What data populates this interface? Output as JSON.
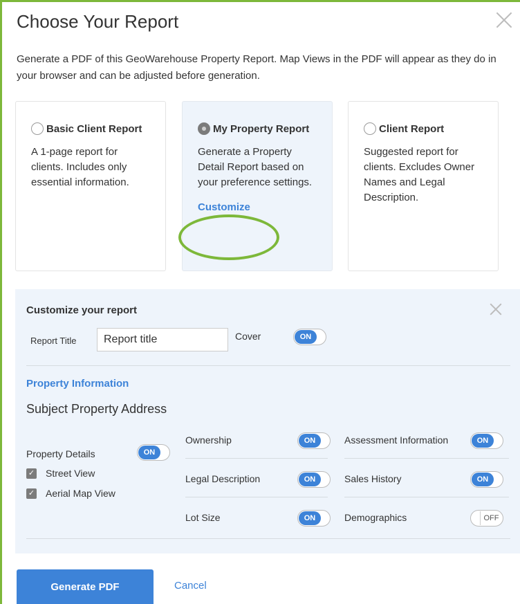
{
  "dialog": {
    "title": "Choose Your Report",
    "intro": "Generate a PDF of this GeoWarehouse Property Report. Map Views in the PDF will appear as they do in your browser and can be adjusted before generation."
  },
  "report_options": [
    {
      "label": "Basic Client Report",
      "description": "A 1-page report for clients. Includes only essential information.",
      "selected": false
    },
    {
      "label": "My Property Report",
      "description": "Generate a Property Detail Report based on your preference settings.",
      "selected": true,
      "link": "Customize"
    },
    {
      "label": "Client Report",
      "description": "Suggested report for clients. Excludes Owner Names and Legal Description.",
      "selected": false
    }
  ],
  "customize": {
    "title": "Customize your report",
    "report_title_label": "Report Title",
    "report_title_value": "Report title",
    "cover_label": "Cover",
    "cover_toggle": "ON",
    "section_title": "Property Information",
    "address_label": "Subject Property Address",
    "property_details": {
      "label": "Property Details",
      "toggle": "ON"
    },
    "checkboxes": [
      {
        "label": "Street View",
        "checked": true
      },
      {
        "label": "Aerial Map View",
        "checked": true
      }
    ],
    "options": [
      {
        "label": "Ownership",
        "toggle": "ON"
      },
      {
        "label": "Legal Description",
        "toggle": "ON"
      },
      {
        "label": "Lot Size",
        "toggle": "ON"
      },
      {
        "label": "Assessment Information",
        "toggle": "ON"
      },
      {
        "label": "Sales History",
        "toggle": "ON"
      },
      {
        "label": "Demographics",
        "toggle": "OFF"
      }
    ]
  },
  "footer": {
    "generate_label": "Generate PDF",
    "cancel_label": "Cancel"
  },
  "colors": {
    "accent": "#3d83d8",
    "highlight": "#7db83a",
    "panel_bg": "#eef4fb"
  }
}
